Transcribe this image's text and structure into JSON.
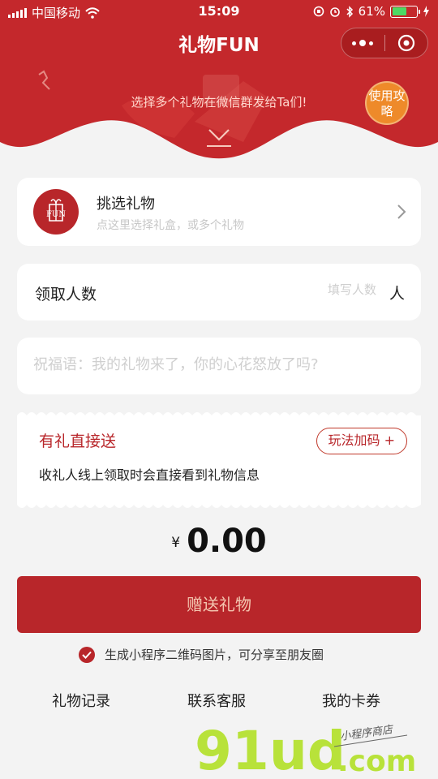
{
  "status": {
    "carrier": "中国移动",
    "time": "15:09",
    "battery": "61%",
    "battery_level": 0.61
  },
  "header": {
    "title": "礼物FUN",
    "hint": "选择多个礼物在微信群发给Ta们!",
    "guide_button": "使用攻略"
  },
  "gift_picker": {
    "title": "挑选礼物",
    "subtitle": "点这里选择礼盒，或多个礼物",
    "logo_text": "FUN"
  },
  "recipients": {
    "label": "领取人数",
    "placeholder": "填写人数",
    "unit": "人"
  },
  "blessing": {
    "placeholder": "祝福语：我的礼物来了，你的心花怒放了吗?"
  },
  "mode": {
    "title": "有礼直接送",
    "description": "收礼人线上领取时会直接看到礼物信息",
    "button": "玩法加码 +"
  },
  "price": {
    "currency": "¥",
    "amount": "0.00"
  },
  "send_button": "赠送礼物",
  "qr_option": {
    "label": "生成小程序二维码图片，可分享至朋友圈",
    "checked": true
  },
  "footer": {
    "gift_records": "礼物记录",
    "contact": "联系客服",
    "coupons": "我的卡券"
  },
  "watermark": {
    "brand": "91ud",
    "domain": ".com",
    "tagline": "小程序商店"
  },
  "colors": {
    "primary_red": "#b8262a",
    "orange": "#ee8a2a",
    "background": "#f3f3f3"
  }
}
